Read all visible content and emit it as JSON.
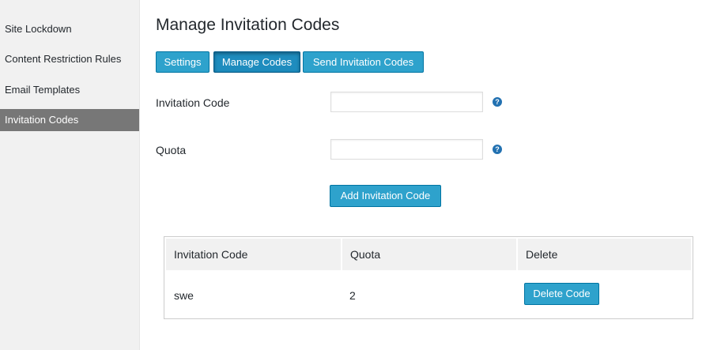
{
  "sidebar": {
    "items": [
      {
        "label": "Site Lockdown"
      },
      {
        "label": "Content Restriction Rules"
      },
      {
        "label": "Email Templates"
      },
      {
        "label": "Invitation Codes",
        "active": true
      }
    ]
  },
  "page": {
    "title": "Manage Invitation Codes"
  },
  "tabs": [
    {
      "label": "Settings"
    },
    {
      "label": "Manage Codes",
      "active": true
    },
    {
      "label": "Send Invitation Codes"
    }
  ],
  "form": {
    "code_label": "Invitation Code",
    "code_value": "",
    "quota_label": "Quota",
    "quota_value": "",
    "help_glyph": "?",
    "add_button": "Add Invitation Code"
  },
  "table": {
    "headers": [
      "Invitation Code",
      "Quota",
      "Delete"
    ],
    "rows": [
      {
        "code": "swe",
        "quota": "2",
        "action": "Delete Code"
      }
    ]
  },
  "colors": {
    "accent": "#2ea2cc",
    "accent_border": "#0074a2",
    "sidebar_active": "#777777",
    "help_icon": "#2271b1"
  }
}
